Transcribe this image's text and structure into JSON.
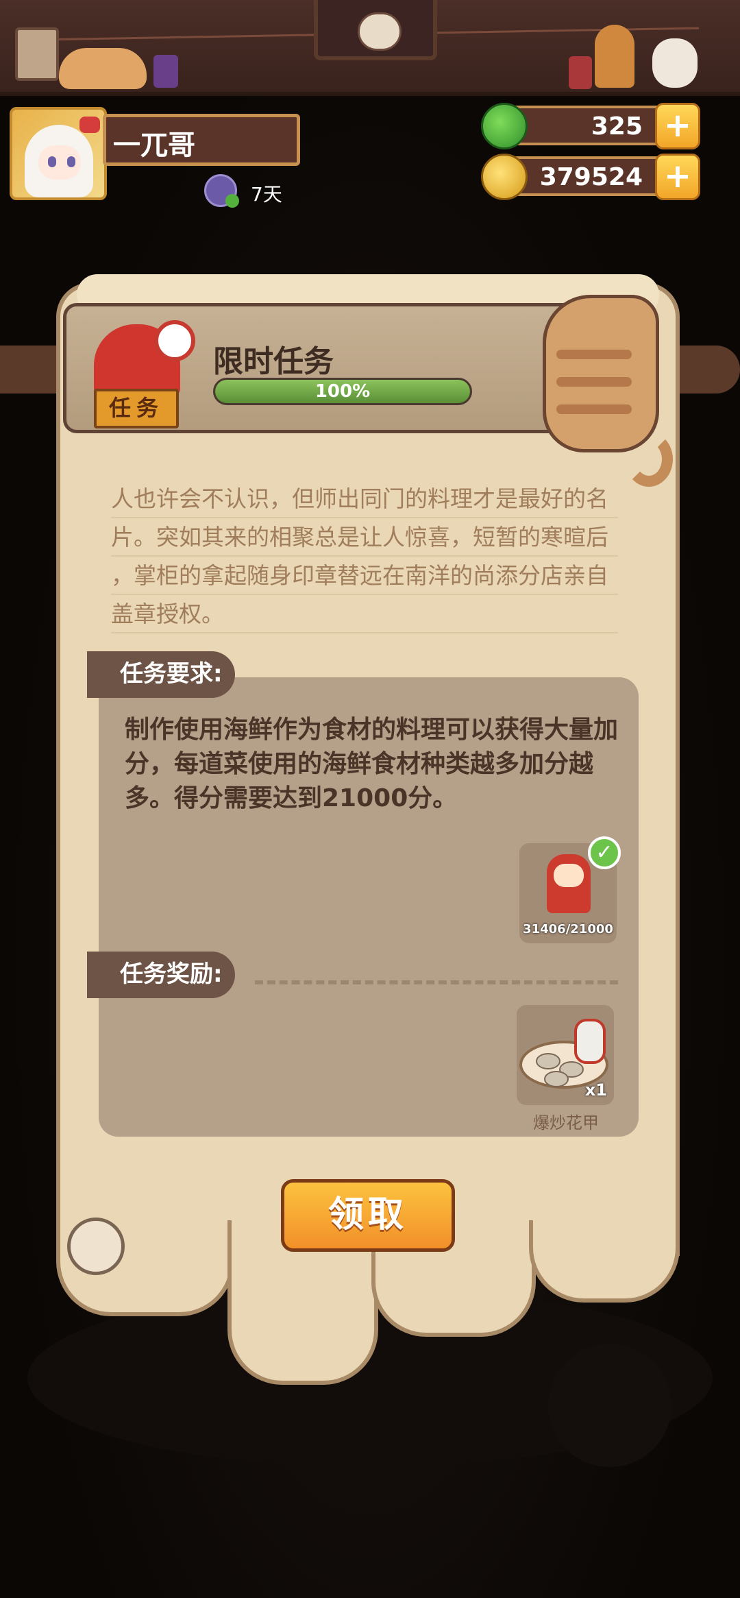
{
  "player": {
    "name": "一兀哥",
    "days": "7天"
  },
  "currency": {
    "jade": {
      "value": "325",
      "icon": "green-jade-icon",
      "color": "#3aa63a"
    },
    "coins": {
      "value": "379524",
      "icon": "gold-coin-icon",
      "color": "#e3b020"
    },
    "plus": "+"
  },
  "task": {
    "tag": "任务",
    "title": "限时任务",
    "progress_percent": 100,
    "progress_text": "100%",
    "story_lines": [
      "人也许会不认识，但师出同门的料理才是最好的名",
      "片。突如其来的相聚总是让人惊喜，短暂的寒暄后",
      "，掌柜的拿起随身印章替远在南洋的尚添分店亲自",
      "盖章授权。"
    ],
    "requirement_label": "任务要求:",
    "requirement_text": "制作使用海鲜作为食材的料理可以获得大量加分，每道菜使用的海鲜食材种类越多加分越多。得分需要达到21000分。",
    "score_text": "31406/21000",
    "reward_label": "任务奖励:",
    "reward_name": "爆炒花甲",
    "reward_qty": "x1",
    "claim_label": "领取"
  },
  "colors": {
    "accent": "#f2a628",
    "progress": "#7ab04a",
    "panel": "#e9d7b5"
  }
}
